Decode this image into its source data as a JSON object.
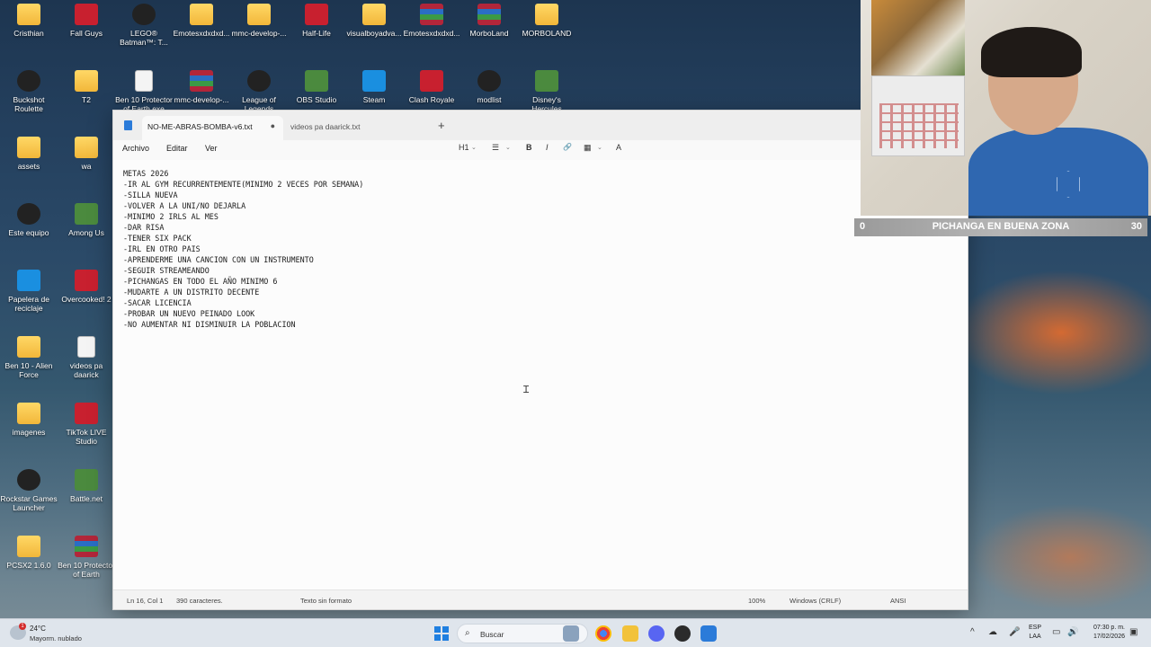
{
  "desktop": {
    "icons": [
      {
        "label": "Cristhian",
        "kind": "folder"
      },
      {
        "label": "Fall Guys",
        "kind": "app"
      },
      {
        "label": "LEGO® Batman™: T...",
        "kind": "app"
      },
      {
        "label": "Emotesxdxdxd...",
        "kind": "folder"
      },
      {
        "label": "mmc-develop-...",
        "kind": "folder"
      },
      {
        "label": "Half-Life",
        "kind": "app"
      },
      {
        "label": "visualboyadva...",
        "kind": "folder"
      },
      {
        "label": "Emotesxdxdxd...",
        "kind": "rar"
      },
      {
        "label": "MorboLand",
        "kind": "rar"
      },
      {
        "label": "MORBOLAND",
        "kind": "folder"
      },
      {
        "label": "Buckshot Roulette",
        "kind": "app"
      },
      {
        "label": "T2",
        "kind": "folder"
      },
      {
        "label": "Ben 10 Protector of Earth.exe",
        "kind": "doc"
      },
      {
        "label": "mmc-develop-...",
        "kind": "rar"
      },
      {
        "label": "League of Legends",
        "kind": "app"
      },
      {
        "label": "OBS Studio",
        "kind": "app"
      },
      {
        "label": "Steam",
        "kind": "app"
      },
      {
        "label": "Clash Royale",
        "kind": "app"
      },
      {
        "label": "modlist",
        "kind": "app"
      },
      {
        "label": "Disney's Hercules",
        "kind": "app"
      },
      {
        "label": "assets",
        "kind": "folder"
      },
      {
        "label": "wa",
        "kind": "folder"
      },
      {
        "label": "Este equipo",
        "kind": "app"
      },
      {
        "label": "Among Us",
        "kind": "app"
      },
      {
        "label": "Papelera de reciclaje",
        "kind": "app"
      },
      {
        "label": "Overcooked! 2",
        "kind": "app"
      },
      {
        "label": "Ben 10 - Alien Force",
        "kind": "folder"
      },
      {
        "label": "videos pa daarick",
        "kind": "doc"
      },
      {
        "label": "imagenes",
        "kind": "folder"
      },
      {
        "label": "TikTok LIVE Studio",
        "kind": "app"
      },
      {
        "label": "Rockstar Games Launcher",
        "kind": "app"
      },
      {
        "label": "Battle.net",
        "kind": "app"
      },
      {
        "label": "PCSX2 1.6.0",
        "kind": "folder"
      },
      {
        "label": "Ben 10 Protector of Earth",
        "kind": "rar"
      }
    ]
  },
  "notepad": {
    "tabs": [
      {
        "label": "NO-ME-ABRAS-BOMBA-v6.txt",
        "active": true,
        "unsaved_marker": "●"
      },
      {
        "label": "videos pa daarick.txt",
        "active": false
      }
    ],
    "new_tab": "+",
    "menu": [
      "Archivo",
      "Editar",
      "Ver"
    ],
    "toolbar": {
      "heading": "H1",
      "list": "☰",
      "bold": "B",
      "italic": "I",
      "link": "🔗",
      "table": "▦",
      "spell": "A"
    },
    "lines": [
      "METAS 2026",
      "-IR AL GYM RECURRENTEMENTE(MINIMO 2 VECES POR SEMANA)",
      "-SILLA NUEVA",
      "-VOLVER A LA UNI/NO DEJARLA",
      "-MINIMO 2 IRLS AL MES",
      "-DAR RISA",
      "-TENER SIX PACK",
      "-IRL EN OTRO PAIS",
      "-APRENDERME UNA CANCION CON UN INSTRUMENTO",
      "-SEGUIR STREAMEANDO",
      "-PICHANGAS EN TODO EL AÑO MINIMO 6",
      "-MUDARTE A UN DISTRITO DECENTE",
      "-SACAR LICENCIA",
      "-PROBAR UN NUEVO PEINADO LOOK",
      "-NO AUMENTAR NI DISMINUIR LA POBLACION"
    ],
    "status": {
      "position": "Ln 16, Col 1",
      "chars": "390 caracteres.",
      "format": "Texto sin formato",
      "zoom": "100%",
      "line_ending": "Windows (CRLF)",
      "encoding": "ANSI"
    }
  },
  "overlay": {
    "score_left": "0",
    "title": "PICHANGA EN BUENA ZONA",
    "score_right": "30"
  },
  "taskbar": {
    "weather_temp": "24°C",
    "weather_cond": "Mayorm. nublado",
    "notif_count": "1",
    "search_placeholder": "Buscar",
    "lang_line1": "ESP",
    "lang_line2": "LAA",
    "time": "07:30 p. m.",
    "date": "17/02/2026"
  }
}
